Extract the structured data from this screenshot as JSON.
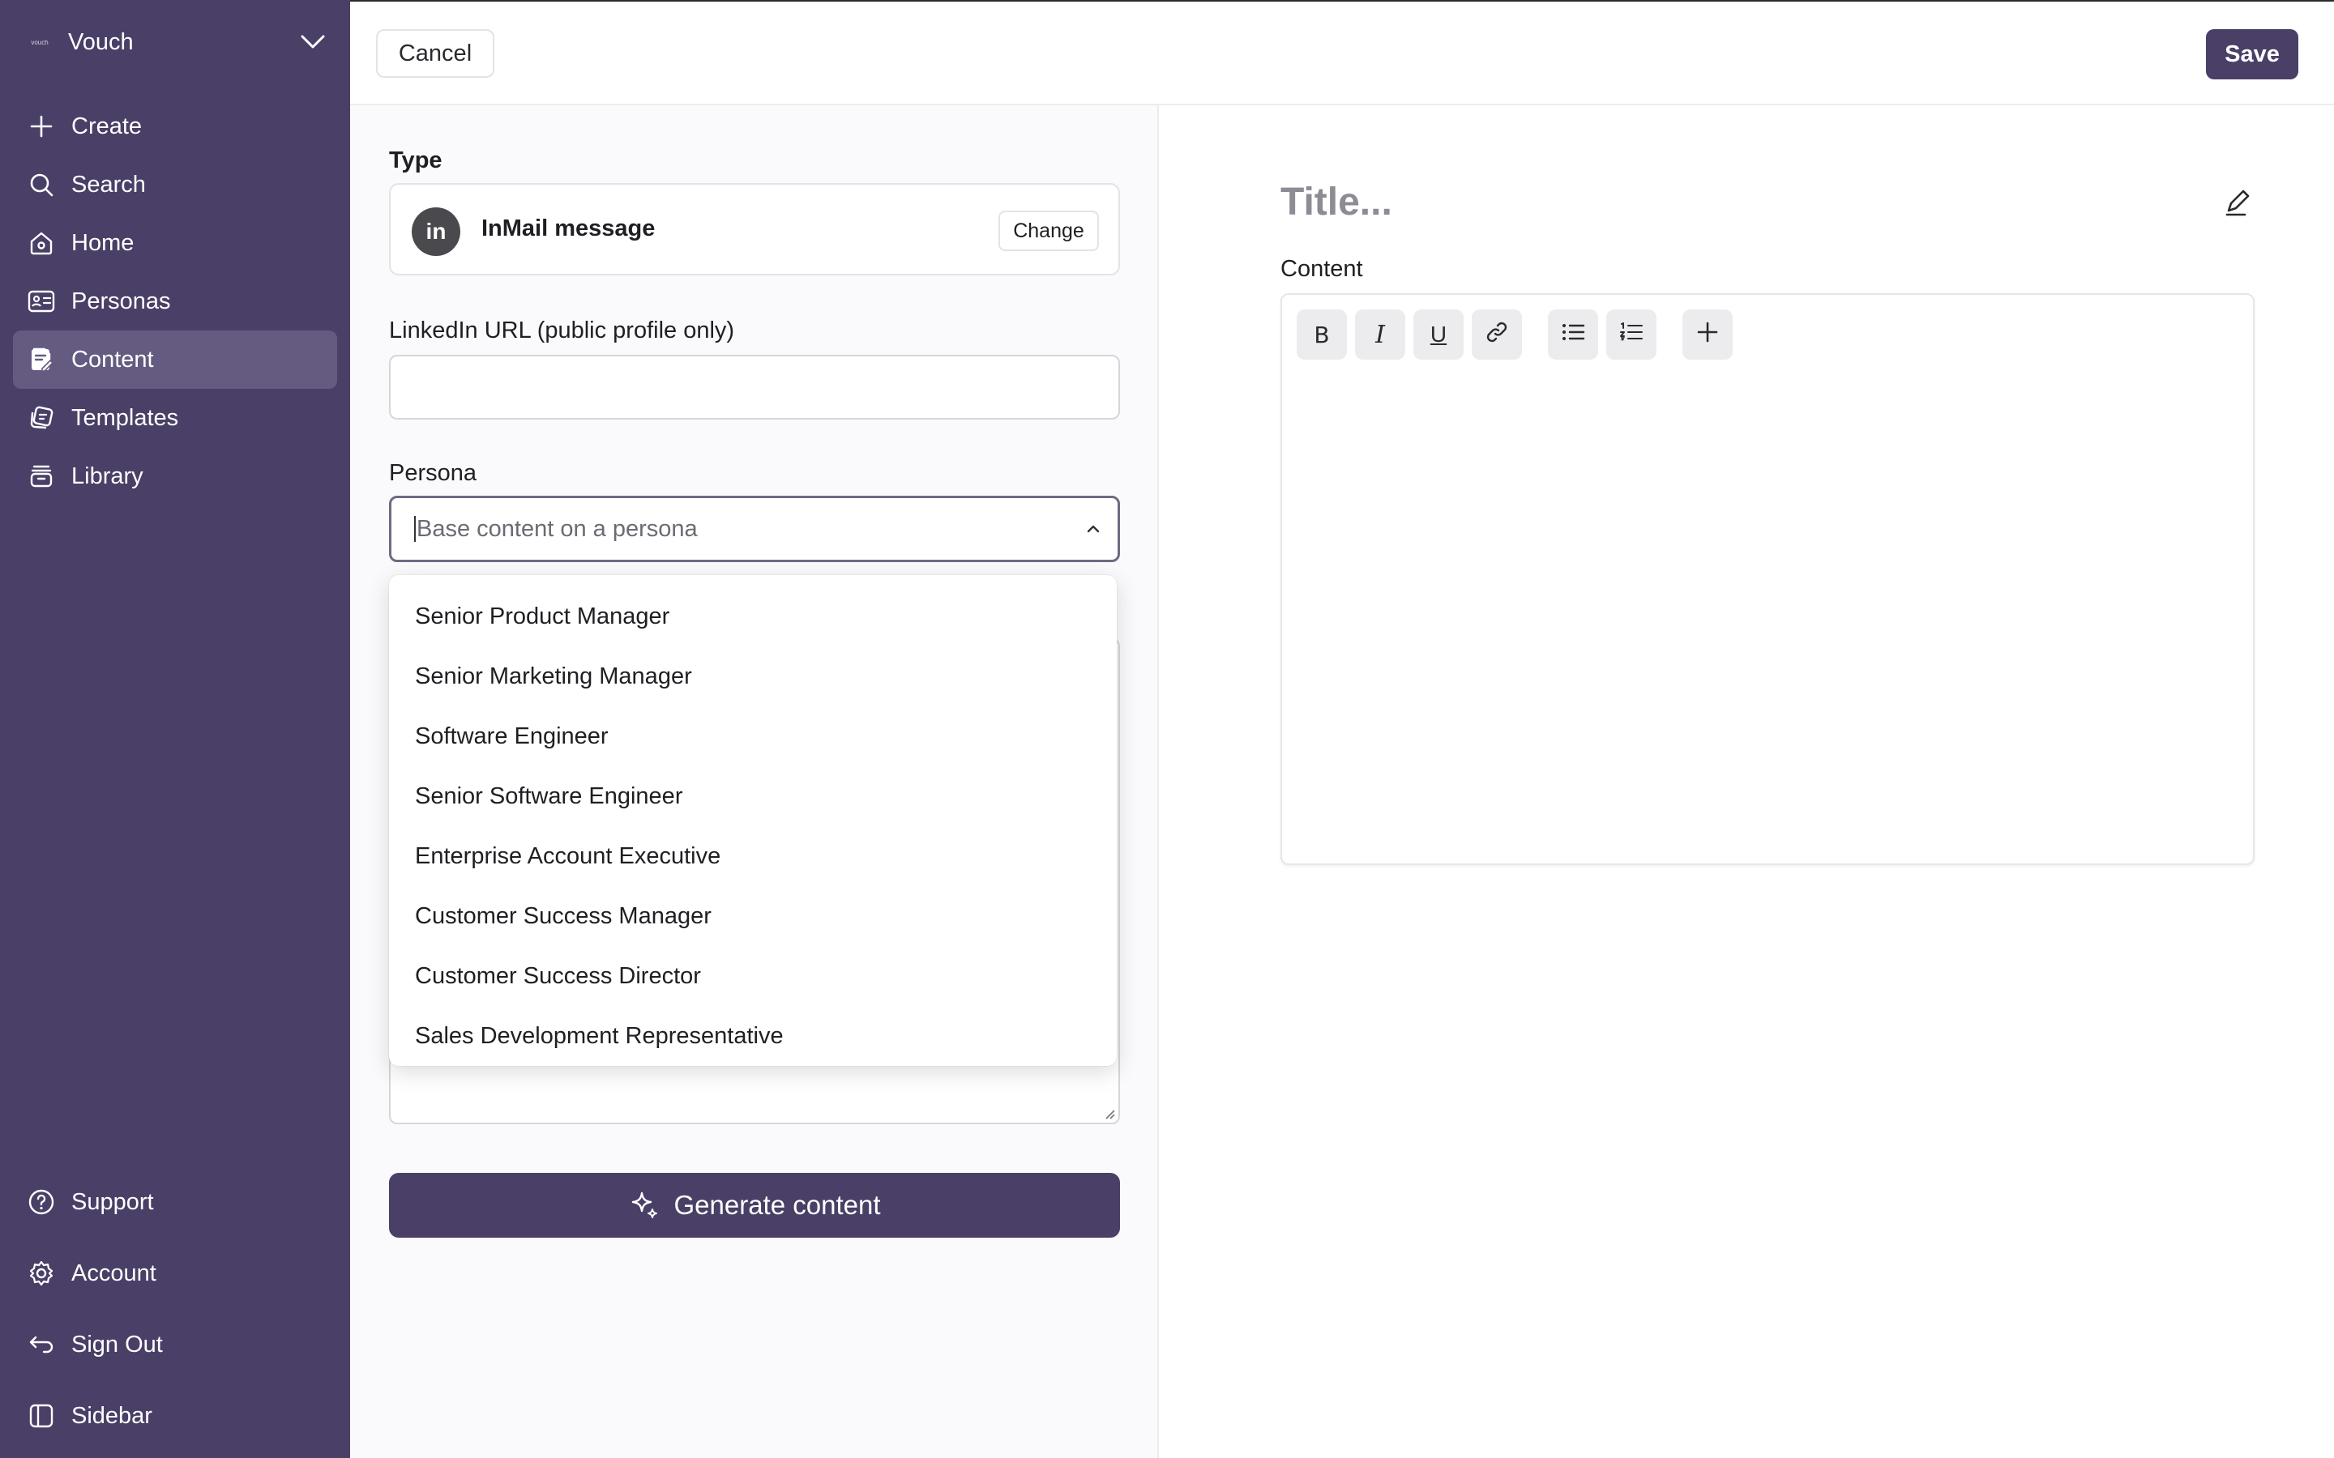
{
  "brand": {
    "name": "Vouch",
    "logo_text": "vouch"
  },
  "sidebar": {
    "items": [
      {
        "label": "Create",
        "icon": "plus-icon"
      },
      {
        "label": "Search",
        "icon": "search-icon"
      },
      {
        "label": "Home",
        "icon": "home-icon"
      },
      {
        "label": "Personas",
        "icon": "id-card-icon"
      },
      {
        "label": "Content",
        "icon": "document-edit-icon",
        "active": true
      },
      {
        "label": "Templates",
        "icon": "templates-icon"
      },
      {
        "label": "Library",
        "icon": "library-icon"
      }
    ],
    "bottom_items": [
      {
        "label": "Support",
        "icon": "help-circle-icon"
      },
      {
        "label": "Account",
        "icon": "gear-icon"
      },
      {
        "label": "Sign Out",
        "icon": "sign-out-icon"
      },
      {
        "label": "Sidebar",
        "icon": "sidebar-toggle-icon"
      }
    ]
  },
  "topbar": {
    "cancel_label": "Cancel",
    "save_label": "Save"
  },
  "form": {
    "type_label": "Type",
    "type_value": "InMail message",
    "type_icon_text": "in",
    "change_label": "Change",
    "url_label": "LinkedIn URL (public profile only)",
    "url_value": "",
    "persona_label": "Persona",
    "persona_placeholder": "Base content on a persona",
    "generate_label": "Generate content"
  },
  "persona_options": [
    "Senior Product Manager",
    "Senior Marketing Manager",
    "Software Engineer",
    "Senior Software Engineer",
    "Enterprise Account Executive",
    "Customer Success Manager",
    "Customer Success Director",
    "Sales Development Representative"
  ],
  "editor": {
    "title_placeholder": "Title...",
    "content_label": "Content",
    "toolbar": {
      "bold": "B",
      "italic": "I",
      "underline": "U"
    }
  },
  "colors": {
    "sidebar_bg": "#4a3f66",
    "sidebar_active": "#655b80",
    "primary_button": "#4a3f66"
  }
}
